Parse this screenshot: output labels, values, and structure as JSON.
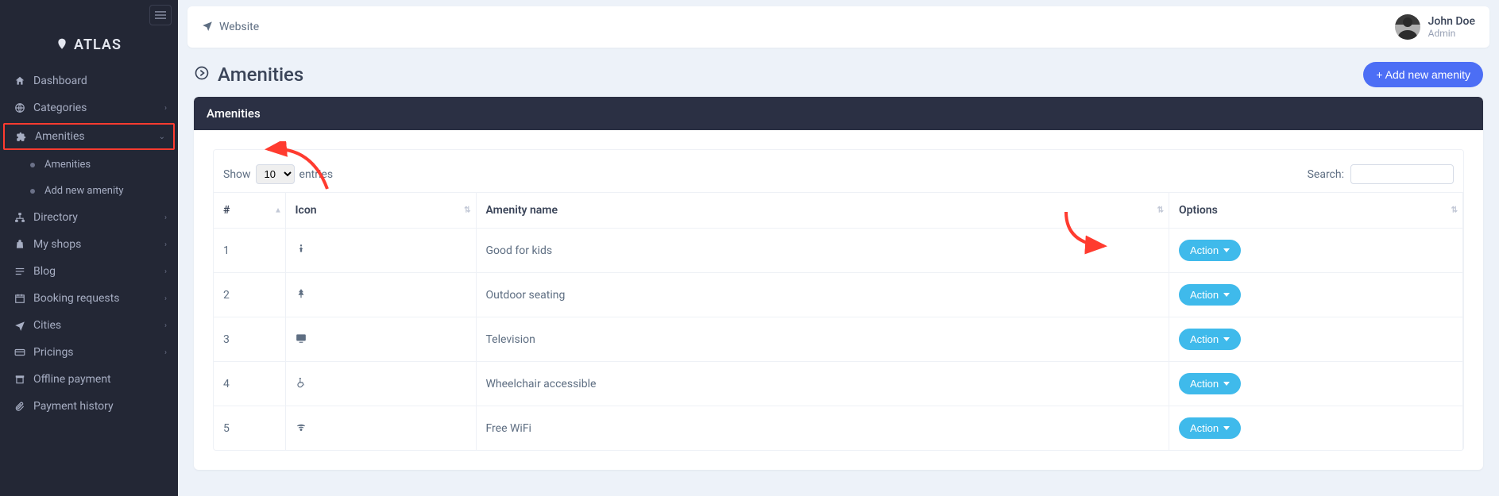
{
  "brand": {
    "name": "ATLAS"
  },
  "topbar": {
    "website_label": "Website"
  },
  "user": {
    "name": "John Doe",
    "role": "Admin"
  },
  "sidebar": {
    "items": [
      {
        "label": "Dashboard"
      },
      {
        "label": "Categories"
      },
      {
        "label": "Amenities"
      },
      {
        "label": "Directory"
      },
      {
        "label": "My shops"
      },
      {
        "label": "Blog"
      },
      {
        "label": "Booking requests"
      },
      {
        "label": "Cities"
      },
      {
        "label": "Pricings"
      },
      {
        "label": "Offline payment"
      },
      {
        "label": "Payment history"
      }
    ],
    "amenities_sub": [
      {
        "label": "Amenities"
      },
      {
        "label": "Add new amenity"
      }
    ]
  },
  "page": {
    "title": "Amenities",
    "add_button": "+ Add new amenity",
    "panel_title": "Amenities"
  },
  "table": {
    "show_label": "Show",
    "entries_label": "entries",
    "length_value": "10",
    "search_label": "Search:",
    "columns": {
      "num": "#",
      "icon": "Icon",
      "name": "Amenity name",
      "options": "Options"
    },
    "action_label": "Action",
    "rows": [
      {
        "num": "1",
        "name": "Good for kids",
        "icon": "child"
      },
      {
        "num": "2",
        "name": "Outdoor seating",
        "icon": "tree"
      },
      {
        "num": "3",
        "name": "Television",
        "icon": "tv"
      },
      {
        "num": "4",
        "name": "Wheelchair accessible",
        "icon": "wheelchair"
      },
      {
        "num": "5",
        "name": "Free WiFi",
        "icon": "wifi"
      }
    ]
  }
}
